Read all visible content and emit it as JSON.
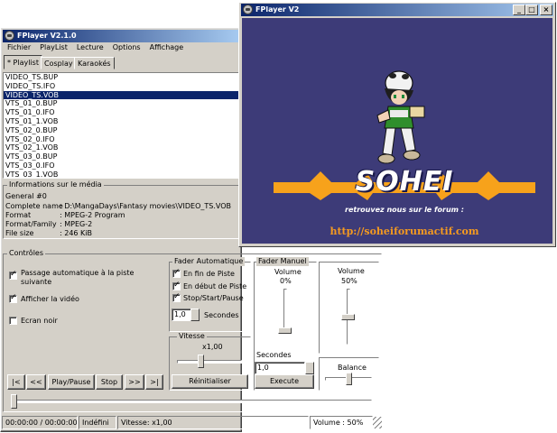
{
  "main_window": {
    "title": "FPlayer V2.1.0",
    "menu": [
      "Fichier",
      "PlayList",
      "Lecture",
      "Options",
      "Affichage"
    ],
    "tabs": [
      {
        "label": "* Playlist",
        "active": true
      },
      {
        "label": "Cosplay",
        "active": false
      },
      {
        "label": "Karaokés",
        "active": false
      }
    ],
    "playlist": {
      "items": [
        "VIDEO_TS.BUP",
        "VIDEO_TS.IFO",
        "VIDEO_TS.VOB",
        "VTS_01_0.BUP",
        "VTS_01_0.IFO",
        "VTS_01_1.VOB",
        "VTS_02_0.BUP",
        "VTS_02_0.IFO",
        "VTS_02_1.VOB",
        "VTS_03_0.BUP",
        "VTS_03_0.IFO",
        "VTS_03_1.VOB"
      ],
      "selected": 2
    },
    "media_info": {
      "label": "Informations sur le média",
      "section": "General #0",
      "rows": [
        {
          "key": "Complete name",
          "value": ": D:\\MangaDays\\Fantasy movies\\VIDEO_TS.VOB"
        },
        {
          "key": "Format",
          "value": ": MPEG-2 Program"
        },
        {
          "key": "Format/Family",
          "value": ": MPEG-2"
        },
        {
          "key": "File size",
          "value": ": 246 KiB"
        }
      ]
    },
    "controls": {
      "label": "Contrôles",
      "auto_next": {
        "label": "Passage automatique à la piste suivante",
        "checked": true
      },
      "show_video": {
        "label": "Afficher la vidéo",
        "checked": true
      },
      "black_screen": {
        "label": "Ecran noir",
        "checked": false
      },
      "transport": {
        "start": "|<",
        "rew": "<<",
        "play_pause": "Play/Pause",
        "stop": "Stop",
        "ffw": ">>",
        "end": ">|"
      }
    },
    "fader_auto": {
      "label": "Fader Automatique",
      "end_of_track": {
        "label": "En fin de Piste",
        "checked": true
      },
      "start_of_track": {
        "label": "En début de Piste",
        "checked": true
      },
      "stop_start_pause": {
        "label": "Stop/Start/Pause",
        "checked": true
      },
      "seconds_value": "1,0",
      "seconds_label": "Secondes"
    },
    "speed": {
      "label": "Vitesse",
      "value": "x1,00",
      "reset_label": "Réinitialiser",
      "level": 0.35
    },
    "fader_manual": {
      "label": "Fader Manuel",
      "volume_label": "Volume",
      "volume_value": "0%",
      "seconds_label": "Secondes",
      "seconds_value": "1,0",
      "execute_label": "Execute",
      "level": 0.0
    },
    "volume": {
      "label": "Volume",
      "value": "50%",
      "level": 0.5
    },
    "balance": {
      "label": "Balance",
      "level": 0.5
    },
    "seek": {
      "level": 0.0
    },
    "status": {
      "time": "00:00:00 / 00:00:00",
      "mode": "Indéfini",
      "speed": "Vitesse: x1,00",
      "volume": "Volume : 50%"
    }
  },
  "video_window": {
    "title": "FPlayer V2",
    "banner": "SOHEI",
    "tagline": "retrouvez nous sur le forum :",
    "url": "http://soheiforumactif.com"
  },
  "colors": {
    "title_active": "#0a246a",
    "window_face": "#d4d0c8",
    "video_bg": "#3d3b78",
    "banner_orange": "#f7a21b",
    "url_orange": "#f59a20"
  }
}
